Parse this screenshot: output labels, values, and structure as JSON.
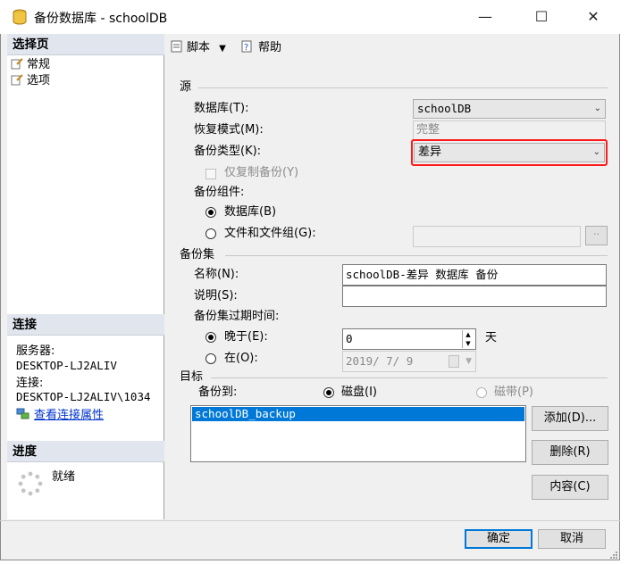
{
  "window": {
    "title": "备份数据库 - schoolDB"
  },
  "left": {
    "select_page_header": "选择页",
    "pages": [
      {
        "label": "常规"
      },
      {
        "label": "选项"
      }
    ],
    "connection_header": "连接",
    "server_label": "服务器:",
    "server_value": "DESKTOP-LJ2ALIV",
    "connection_label": "连接:",
    "connection_value": "DESKTOP-LJ2ALIV\\1034",
    "view_props_link": "查看连接属性",
    "progress_header": "进度",
    "progress_status": "就绪"
  },
  "toolbar": {
    "script_label": "脚本",
    "help_label": "帮助"
  },
  "source": {
    "group_label": "源",
    "database_label": "数据库(T):",
    "database_value": "schoolDB",
    "recovery_label": "恢复模式(M):",
    "recovery_value": "完整",
    "backup_type_label": "备份类型(K):",
    "backup_type_value": "差异",
    "copy_only_label": "仅复制备份(Y)",
    "component_label": "备份组件:",
    "component_database": "数据库(B)",
    "component_files": "文件和文件组(G):",
    "files_browse": "··"
  },
  "backup_set": {
    "group_label": "备份集",
    "name_label": "名称(N):",
    "name_value": "schoolDB-差异 数据库 备份",
    "desc_label": "说明(S):",
    "desc_value": "",
    "expire_label": "备份集过期时间:",
    "after_label": "晚于(E):",
    "after_value": "0",
    "after_unit": "天",
    "on_label": "在(O):",
    "on_value": "2019/ 7/ 9"
  },
  "destination": {
    "group_label": "目标",
    "backup_to_label": "备份到:",
    "disk_label": "磁盘(I)",
    "tape_label": "磁带(P)",
    "items": [
      "schoolDB_backup"
    ],
    "add_button": "添加(D)...",
    "remove_button": "删除(R)",
    "contents_button": "内容(C)"
  },
  "footer": {
    "ok_button": "确定",
    "cancel_button": "取消"
  },
  "colors": {
    "accent": "#0078d7",
    "highlight": "#ff1a1a",
    "selection": "#0078d7"
  }
}
